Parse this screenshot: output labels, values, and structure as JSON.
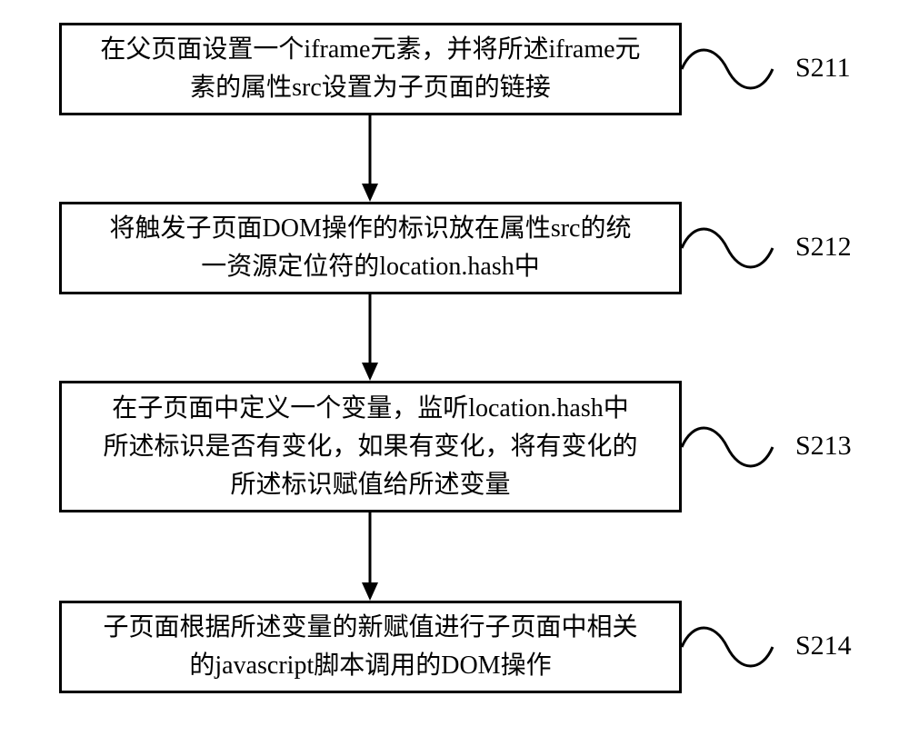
{
  "chart_data": {
    "type": "flowchart",
    "direction": "top-to-bottom",
    "nodes": [
      {
        "id": "S211",
        "label": "S211",
        "text": "在父页面设置一个iframe元素，并将所述iframe元\n素的属性src设置为子页面的链接"
      },
      {
        "id": "S212",
        "label": "S212",
        "text": "将触发子页面DOM操作的标识放在属性src的统\n一资源定位符的location.hash中"
      },
      {
        "id": "S213",
        "label": "S213",
        "text": "在子页面中定义一个变量，监听location.hash中\n所述标识是否有变化，如果有变化，将有变化的\n所述标识赋值给所述变量"
      },
      {
        "id": "S214",
        "label": "S214",
        "text": "子页面根据所述变量的新赋值进行子页面中相关\n的javascript脚本调用的DOM操作"
      }
    ],
    "edges": [
      {
        "from": "S211",
        "to": "S212"
      },
      {
        "from": "S212",
        "to": "S213"
      },
      {
        "from": "S213",
        "to": "S214"
      }
    ]
  }
}
